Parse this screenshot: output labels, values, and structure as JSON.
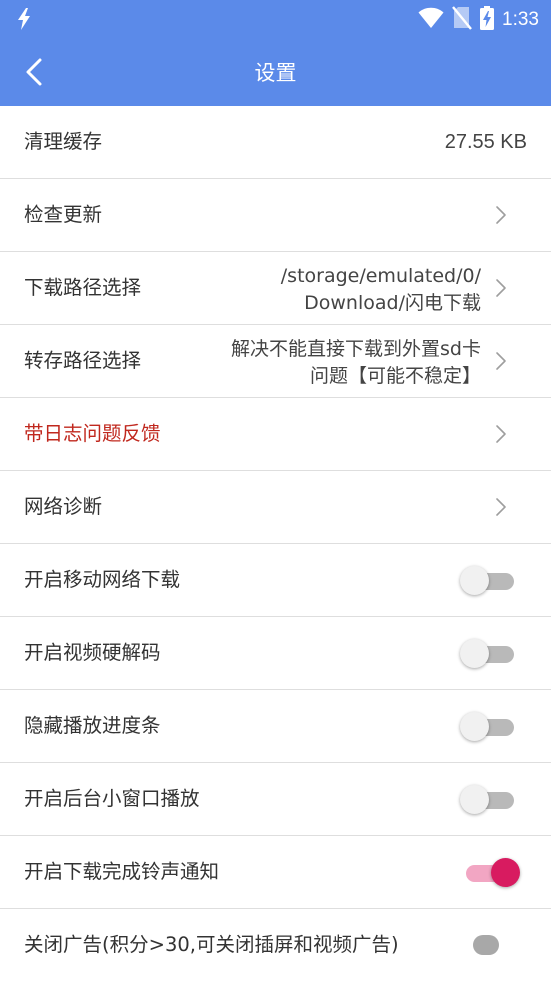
{
  "status_bar": {
    "time": "1:33",
    "icons": [
      "flash-icon",
      "wifi-icon",
      "no-sim-icon",
      "battery-charging-icon"
    ]
  },
  "toolbar": {
    "title": "设置",
    "back_icon": "chevron-left-icon"
  },
  "colors": {
    "app_bar": "#5b8ae9",
    "highlight_text": "#c0281e",
    "switch_on": "#d81b60",
    "switch_on_track": "#f2a6c3",
    "switch_off_track": "#b9b9b9",
    "divider": "#dedede"
  },
  "settings": [
    {
      "label": "清理缓存",
      "value": "27.55 KB"
    },
    {
      "label": "检查更新"
    },
    {
      "label": "下载路径选择",
      "value_lines": [
        "/storage/emulated/0/",
        "Download/闪电下载"
      ]
    },
    {
      "label": "转存路径选择",
      "value_lines": [
        "解决不能直接下载到外置sd卡",
        "问题【可能不稳定】"
      ]
    },
    {
      "label": "带日志问题反馈"
    },
    {
      "label": "网络诊断"
    },
    {
      "label": "开启移动网络下载",
      "switch_on": false
    },
    {
      "label": "开启视频硬解码",
      "switch_on": false
    },
    {
      "label": "隐藏播放进度条",
      "switch_on": false
    },
    {
      "label": "开启后台小窗口播放",
      "switch_on": false
    },
    {
      "label": "开启下载完成铃声通知",
      "switch_on": true
    },
    {
      "label": "关闭广告(积分>30,可关闭插屏和视频广告)",
      "switch_on": false
    }
  ]
}
